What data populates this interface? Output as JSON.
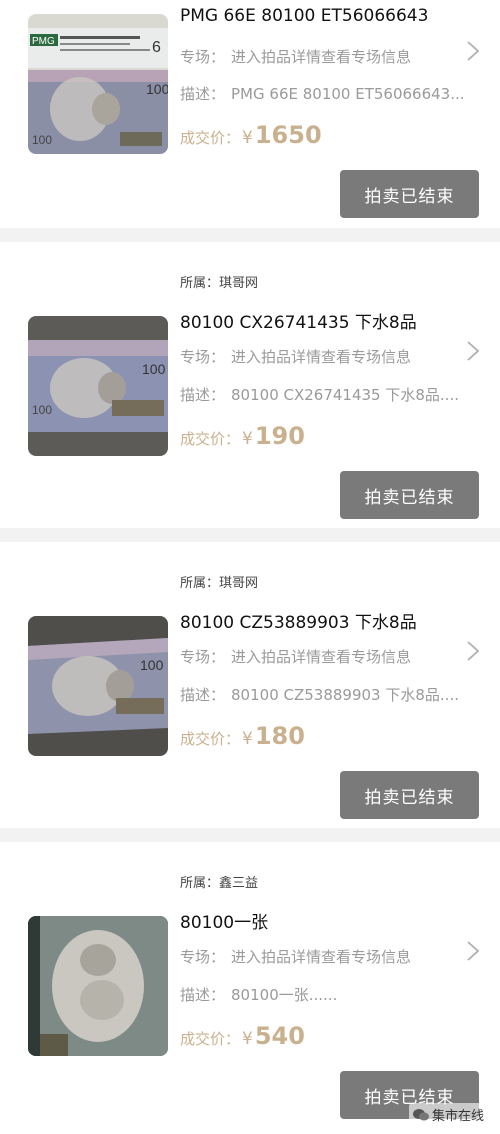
{
  "labels": {
    "source_prefix": "所属：",
    "session_key": "专场：",
    "session_value": "进入拍品详情查看专场信息",
    "desc_key": "描述：",
    "price_label": "成交价：",
    "currency": "¥",
    "ended_button": "拍卖已结束"
  },
  "colors": {
    "price": "#c9b18f",
    "button_bg": "#7a7a7a",
    "page_bg": "#f2f2f2"
  },
  "items": [
    {
      "title": "PMG 66E 80100 ET56066643",
      "description": "PMG 66E 80100 ET56066643...",
      "price": "1650",
      "thumb": "pmg-slab-banknote"
    },
    {
      "source": "琪哥网",
      "title": "80100 CX26741435 下水8品",
      "description": "80100 CX26741435 下水8品....",
      "price": "190",
      "thumb": "banknote"
    },
    {
      "source": "琪哥网",
      "title": "80100 CZ53889903 下水8品",
      "description": "80100 CZ53889903 下水8品....",
      "price": "180",
      "thumb": "banknote-angled"
    },
    {
      "source": "鑫三益",
      "title": "80100一张",
      "description": "80100一张......",
      "price": "540",
      "thumb": "banknote-closeup"
    }
  ],
  "watermark": {
    "text": "集市在线",
    "icon": "wechat-icon"
  }
}
